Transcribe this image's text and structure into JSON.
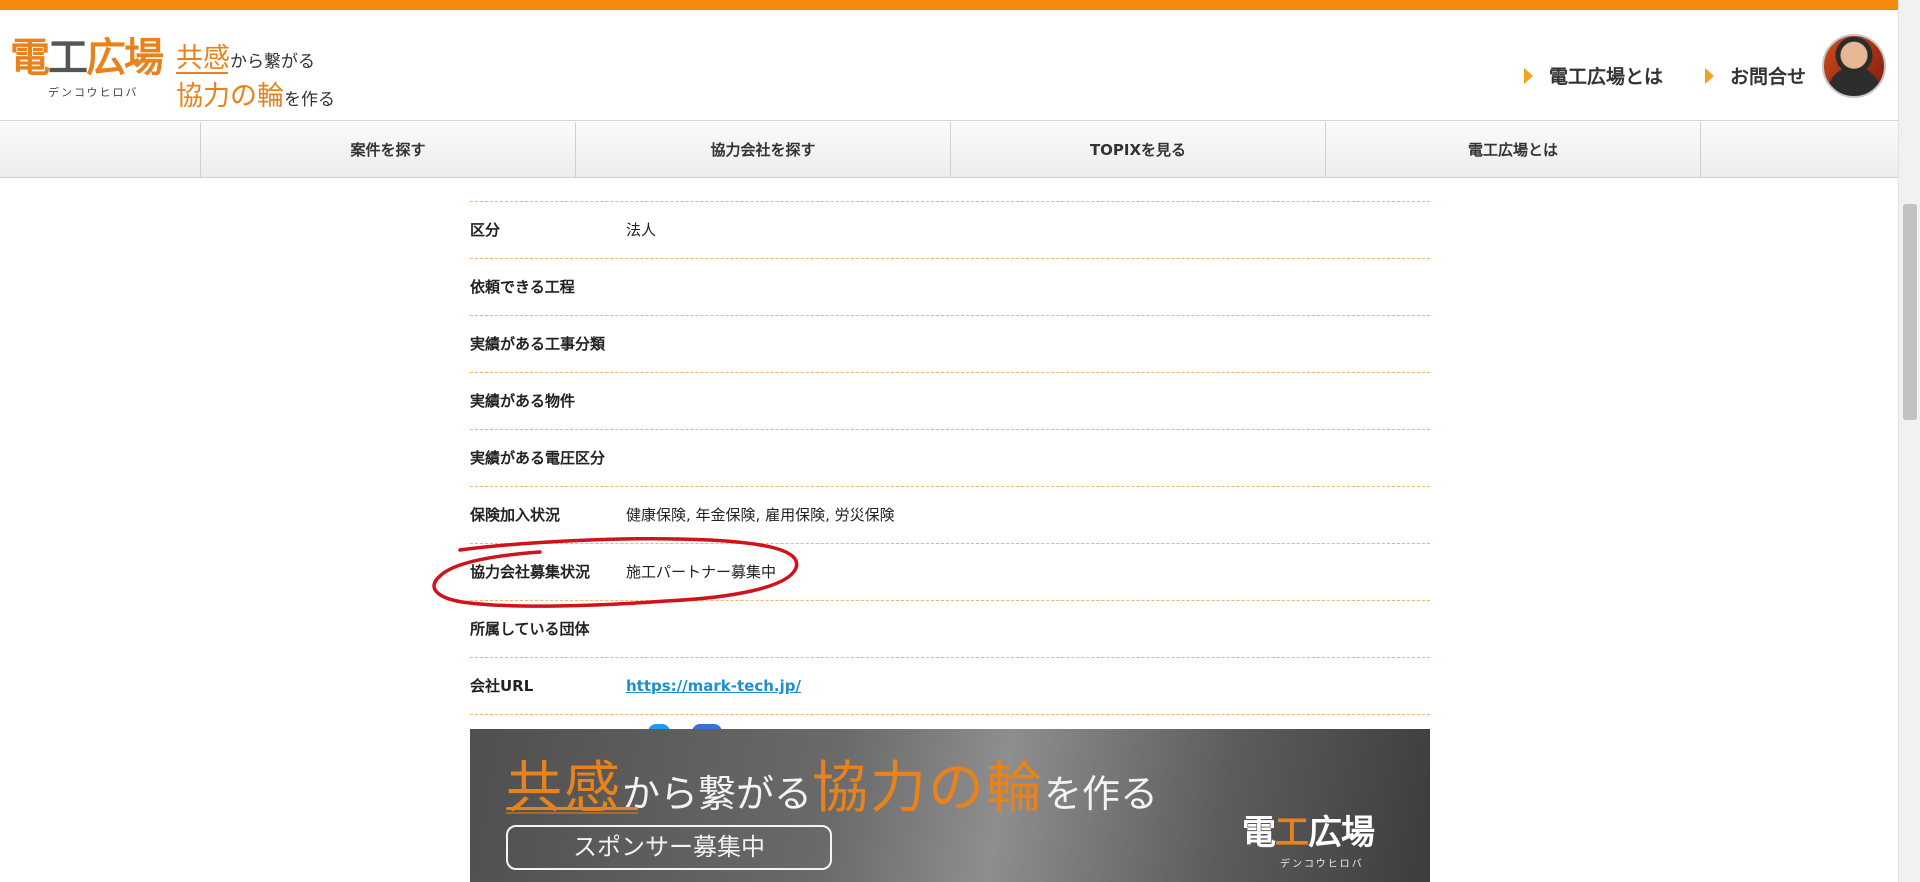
{
  "header": {
    "logo_main_1": "電",
    "logo_main_2": "工",
    "logo_main_3": "広場",
    "logo_sub": "デンコウヒロバ",
    "tagline": {
      "l1_big": "共感",
      "l1_small": "から繋がる",
      "l2_big": "協力の輪",
      "l2_small": "を作る"
    },
    "nav": [
      {
        "label": "電工広場とは"
      },
      {
        "label": "お問合せ"
      }
    ]
  },
  "mainnav": [
    {
      "label": "案件を探す"
    },
    {
      "label": "協力会社を探す"
    },
    {
      "label": "TOPIXを見る"
    },
    {
      "label": "電工広場とは"
    }
  ],
  "details": [
    {
      "label": "区分",
      "value": "法人"
    },
    {
      "label": "依頼できる工程",
      "value": ""
    },
    {
      "label": "実績がある工事分類",
      "value": ""
    },
    {
      "label": "実績がある物件",
      "value": ""
    },
    {
      "label": "実績がある電圧区分",
      "value": ""
    },
    {
      "label": "保険加入状況",
      "value": "健康保険, 年金保険, 雇用保険, 労災保険"
    },
    {
      "label": "協力会社募集状況",
      "value": "施工パートナー募集中"
    },
    {
      "label": "所属している団体",
      "value": ""
    },
    {
      "label": "会社URL",
      "value": "https://mark-tech.jp/"
    }
  ],
  "banner": {
    "l1_big": "共感",
    "l1_small": "から繋がる",
    "l2_big": "協力の輪",
    "l2_small": "を作る",
    "sponsor": "スポンサー募集中",
    "logo_main_1": "電",
    "logo_main_2": "工",
    "logo_main_3": "広場",
    "logo_sub": "デンコウヒロバ"
  },
  "colors": {
    "accent": "#f5890b",
    "annotation": "#d0121b",
    "link": "#1e8fd0"
  },
  "icons": {
    "nav_arrow": "triangle-right-icon",
    "annotation": "red-circle-annotation"
  }
}
